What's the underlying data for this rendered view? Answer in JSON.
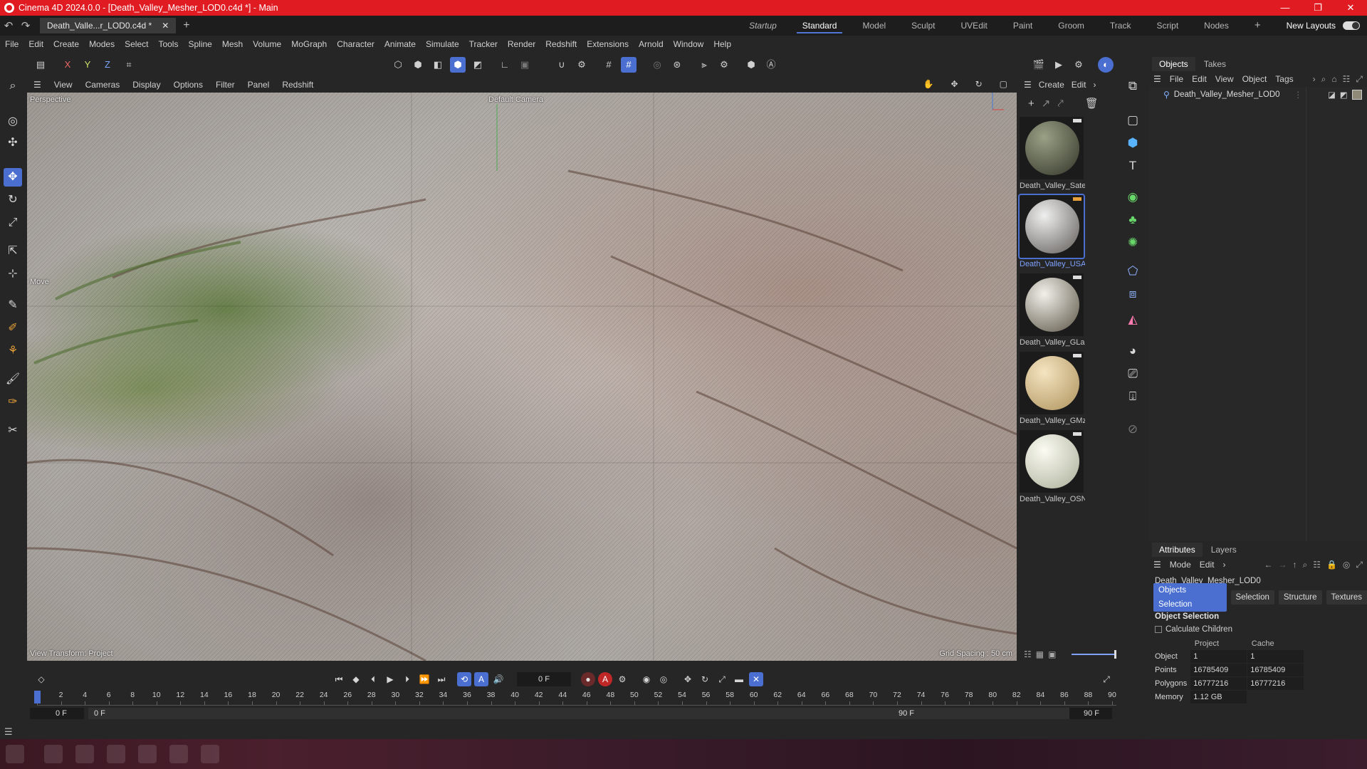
{
  "app": {
    "title": "Cinema 4D 2024.0.0 - [Death_Valley_Mesher_LOD0.c4d *] - Main",
    "window_buttons": [
      "—",
      "❐",
      "✕"
    ]
  },
  "doc_tab": {
    "label": "Death_Valle...r_LOD0.c4d *",
    "close": "✕",
    "add": "+"
  },
  "layouts": {
    "items": [
      "Startup",
      "Standard",
      "Model",
      "Sculpt",
      "UVEdit",
      "Paint",
      "Groom",
      "Track",
      "Script",
      "Nodes"
    ],
    "active": "Standard",
    "add": "+",
    "new_layouts": "New Layouts"
  },
  "menu": [
    "File",
    "Edit",
    "Create",
    "Modes",
    "Select",
    "Tools",
    "Spline",
    "Mesh",
    "Volume",
    "MoGraph",
    "Character",
    "Animate",
    "Simulate",
    "Tracker",
    "Render",
    "Redshift",
    "Extensions",
    "Arnold",
    "Window",
    "Help"
  ],
  "axis_toggles": {
    "x": "X",
    "y": "Y",
    "z": "Z"
  },
  "viewport": {
    "menu": [
      "View",
      "Cameras",
      "Display",
      "Options",
      "Filter",
      "Panel",
      "Redshift"
    ],
    "label_perspective": "Perspective",
    "label_camera": "Default Camera",
    "label_move": "Move",
    "label_view_transform": "View Transform: Project",
    "label_grid": "Grid Spacing : 50 cm"
  },
  "material_manager": {
    "menu": [
      "Create",
      "Edit"
    ],
    "materials": [
      {
        "name": "Death_Valley_Sate",
        "selected": false,
        "color_a": "#9aa085",
        "color_b": "#3d4032"
      },
      {
        "name": "Death_Valley_USA",
        "selected": true,
        "color_a": "#efefef",
        "color_b": "#6d6a66"
      },
      {
        "name": "Death_Valley_GLar",
        "selected": false,
        "color_a": "#f2f0ea",
        "color_b": "#6a6456"
      },
      {
        "name": "Death_Valley_GMz",
        "selected": false,
        "color_a": "#f4e4c0",
        "color_b": "#b59a66"
      },
      {
        "name": "Death_Valley_OSN",
        "selected": false,
        "color_a": "#fbfbf2",
        "color_b": "#b3b6a2"
      }
    ]
  },
  "object_manager": {
    "tabs": [
      "Objects",
      "Takes"
    ],
    "menu": [
      "File",
      "Edit",
      "View",
      "Object",
      "Tags"
    ],
    "objects": [
      {
        "name": "Death_Valley_Mesher_LOD0"
      }
    ]
  },
  "attributes": {
    "tabs": [
      "Attributes",
      "Layers"
    ],
    "menu": [
      "Mode",
      "Edit"
    ],
    "object_name": "Death_Valley_Mesher_LOD0",
    "sub_tabs": [
      "Objects Selection",
      "Selection",
      "Structure",
      "Textures"
    ],
    "active_sub_tab": "Objects Selection",
    "section": "Object Selection",
    "calculate_children": "Calculate Children",
    "col_project": "Project",
    "col_cache": "Cache",
    "rows": [
      {
        "label": "Object",
        "project": "1",
        "cache": "1"
      },
      {
        "label": "Points",
        "project": "16785409",
        "cache": "16785409"
      },
      {
        "label": "Polygons",
        "project": "16777216",
        "cache": "16777216"
      },
      {
        "label": "Memory",
        "project": "1.12 GB",
        "cache": ""
      }
    ]
  },
  "timeline": {
    "current_frame": "0 F",
    "ticks": [
      "0",
      "2",
      "4",
      "6",
      "8",
      "10",
      "12",
      "14",
      "16",
      "18",
      "20",
      "22",
      "24",
      "26",
      "28",
      "30",
      "32",
      "34",
      "36",
      "38",
      "40",
      "42",
      "44",
      "46",
      "48",
      "50",
      "52",
      "54",
      "56",
      "58",
      "60",
      "62",
      "64",
      "66",
      "68",
      "70",
      "72",
      "74",
      "76",
      "78",
      "80",
      "82",
      "84",
      "86",
      "88",
      "90"
    ],
    "tick_max": 90,
    "range_start": "0 F",
    "range_start2": "0 F",
    "range_end": "90 F",
    "range_end2": "90 F"
  },
  "colors": {
    "title_bar": "#e01b22",
    "accent": "#4a6fd1"
  }
}
